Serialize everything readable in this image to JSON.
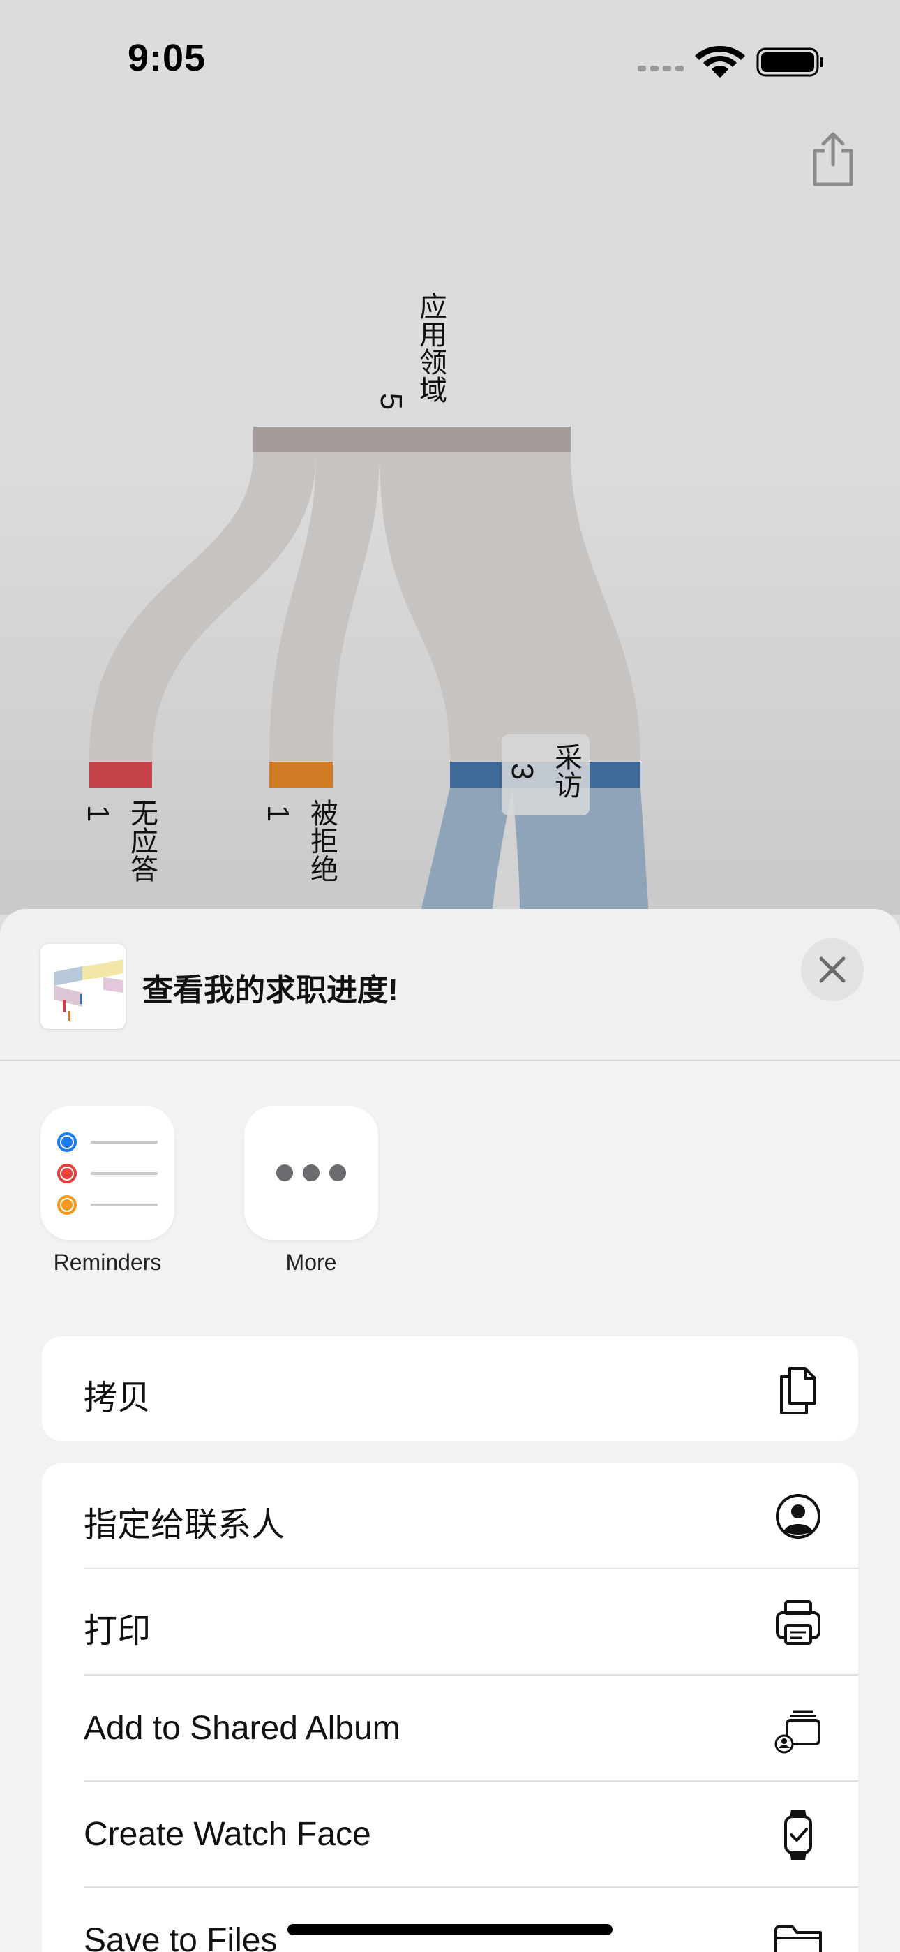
{
  "status_bar": {
    "time": "9:05"
  },
  "sankey": {
    "source": {
      "label": "应用领域",
      "count": "5"
    },
    "targets": [
      {
        "label": "无应答",
        "count": "1",
        "color": "#c2444a"
      },
      {
        "label": "被拒绝",
        "count": "1",
        "color": "#d27b26"
      },
      {
        "label": "采访",
        "count": "3",
        "color": "#3f6a98"
      }
    ]
  },
  "share_sheet": {
    "title": "查看我的求职进度!",
    "apps": [
      {
        "label": "Reminders",
        "icon": "reminders-icon"
      },
      {
        "label": "More",
        "icon": "more-icon"
      }
    ],
    "group1": [
      {
        "label": "拷贝",
        "icon": "copy-icon"
      }
    ],
    "group2": [
      {
        "label": "指定给联系人",
        "icon": "contact-icon"
      },
      {
        "label": "打印",
        "icon": "printer-icon"
      },
      {
        "label": "Add to Shared Album",
        "icon": "shared-album-icon"
      },
      {
        "label": "Create Watch Face",
        "icon": "watch-icon"
      },
      {
        "label": "Save to Files",
        "icon": "folder-icon"
      }
    ]
  },
  "colors": {
    "background": "#dcdcdc",
    "sheet": "#f2f2f2",
    "link": "#c6c3c0",
    "source_node": "#a39c98",
    "interview_link": "#8fa4b8"
  }
}
